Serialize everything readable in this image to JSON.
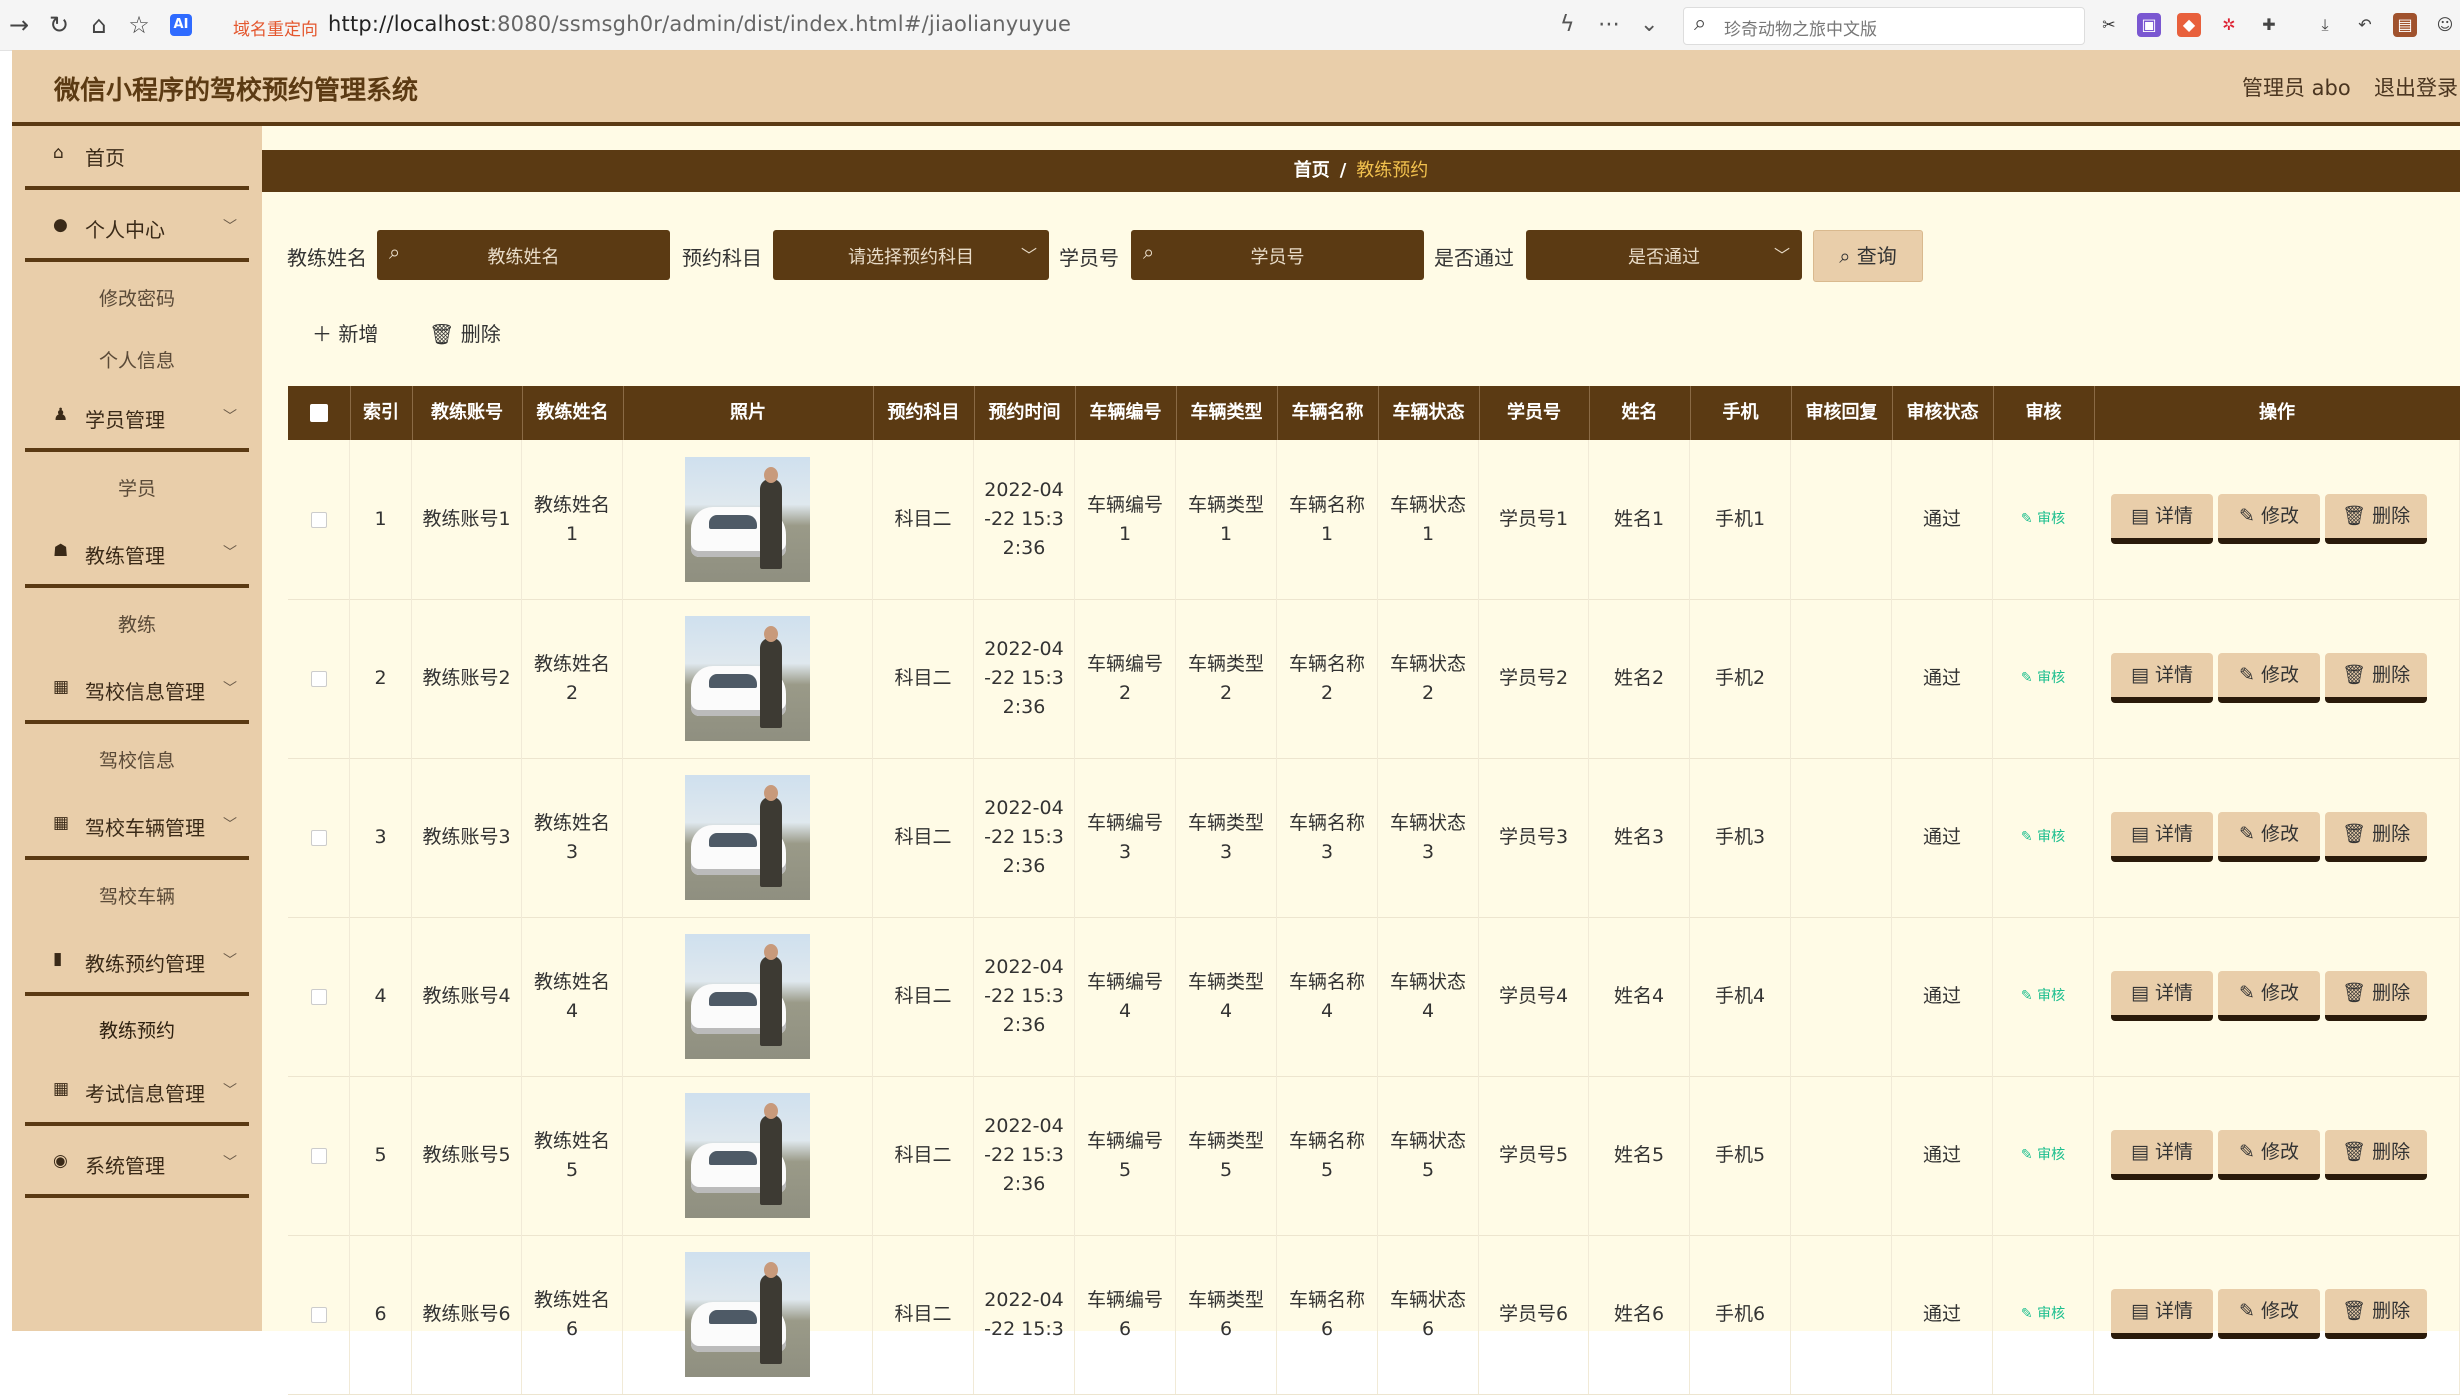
{
  "browser": {
    "redirect_label": "域名重定向",
    "url_host": "http://localhost",
    "url_rest": ":8080/ssmsgh0r/admin/dist/index.html#/jiaolianyuyue",
    "search_text": "珍奇动物之旅中文版"
  },
  "header": {
    "title": "微信小程序的驾校预约管理系统",
    "user": "管理员 abo",
    "logout": "退出登录"
  },
  "sidebar": {
    "home": "首页",
    "groups": [
      {
        "label": "个人中心",
        "subs": [
          "修改密码",
          "个人信息"
        ]
      },
      {
        "label": "学员管理",
        "subs": [
          "学员"
        ]
      },
      {
        "label": "教练管理",
        "subs": [
          "教练"
        ]
      },
      {
        "label": "驾校信息管理",
        "subs": [
          "驾校信息"
        ]
      },
      {
        "label": "驾校车辆管理",
        "subs": [
          "驾校车辆"
        ]
      },
      {
        "label": "教练预约管理",
        "subs": [
          "教练预约"
        ]
      },
      {
        "label": "考试信息管理",
        "subs": []
      },
      {
        "label": "系统管理",
        "subs": []
      }
    ]
  },
  "breadcrumb": {
    "home": "首页",
    "sep": "/",
    "current": "教练预约"
  },
  "filters": {
    "coach_name_label": "教练姓名",
    "coach_name_placeholder": "教练姓名",
    "subject_label": "预约科目",
    "subject_placeholder": "请选择预约科目",
    "student_no_label": "学员号",
    "student_no_placeholder": "学员号",
    "passed_label": "是否通过",
    "passed_placeholder": "是否通过",
    "query": "查询"
  },
  "actions": {
    "add": "新增",
    "delete": "删除"
  },
  "table": {
    "headers": [
      "索引",
      "教练账号",
      "教练姓名",
      "照片",
      "预约科目",
      "预约时间",
      "车辆编号",
      "车辆类型",
      "车辆名称",
      "车辆状态",
      "学员号",
      "姓名",
      "手机",
      "审核回复",
      "审核状态",
      "审核",
      "操作"
    ],
    "audit_label": "审核",
    "op_labels": {
      "detail": "详情",
      "edit": "修改",
      "delete": "删除"
    },
    "rows": [
      {
        "index": "1",
        "account": "教练账号1",
        "name": "教练姓名\n1",
        "subject": "科目二",
        "time": "2022-04\n-22 15:3\n2:36",
        "car_no": "车辆编号\n1",
        "car_type": "车辆类型\n1",
        "car_name": "车辆名称\n1",
        "car_status": "车辆状态\n1",
        "student_no": "学员号1",
        "student_name": "姓名1",
        "phone": "手机1",
        "reply": "",
        "status": "通过"
      },
      {
        "index": "2",
        "account": "教练账号2",
        "name": "教练姓名\n2",
        "subject": "科目二",
        "time": "2022-04\n-22 15:3\n2:36",
        "car_no": "车辆编号\n2",
        "car_type": "车辆类型\n2",
        "car_name": "车辆名称\n2",
        "car_status": "车辆状态\n2",
        "student_no": "学员号2",
        "student_name": "姓名2",
        "phone": "手机2",
        "reply": "",
        "status": "通过"
      },
      {
        "index": "3",
        "account": "教练账号3",
        "name": "教练姓名\n3",
        "subject": "科目二",
        "time": "2022-04\n-22 15:3\n2:36",
        "car_no": "车辆编号\n3",
        "car_type": "车辆类型\n3",
        "car_name": "车辆名称\n3",
        "car_status": "车辆状态\n3",
        "student_no": "学员号3",
        "student_name": "姓名3",
        "phone": "手机3",
        "reply": "",
        "status": "通过"
      },
      {
        "index": "4",
        "account": "教练账号4",
        "name": "教练姓名\n4",
        "subject": "科目二",
        "time": "2022-04\n-22 15:3\n2:36",
        "car_no": "车辆编号\n4",
        "car_type": "车辆类型\n4",
        "car_name": "车辆名称\n4",
        "car_status": "车辆状态\n4",
        "student_no": "学员号4",
        "student_name": "姓名4",
        "phone": "手机4",
        "reply": "",
        "status": "通过"
      },
      {
        "index": "5",
        "account": "教练账号5",
        "name": "教练姓名\n5",
        "subject": "科目二",
        "time": "2022-04\n-22 15:3\n2:36",
        "car_no": "车辆编号\n5",
        "car_type": "车辆类型\n5",
        "car_name": "车辆名称\n5",
        "car_status": "车辆状态\n5",
        "student_no": "学员号5",
        "student_name": "姓名5",
        "phone": "手机5",
        "reply": "",
        "status": "通过"
      },
      {
        "index": "6",
        "account": "教练账号6",
        "name": "教练姓名\n6",
        "subject": "科目二",
        "time": "2022-04\n-22 15:3",
        "car_no": "车辆编号\n6",
        "car_type": "车辆类型\n6",
        "car_name": "车辆名称\n6",
        "car_status": "车辆状态\n6",
        "student_no": "学员号6",
        "student_name": "姓名6",
        "phone": "手机6",
        "reply": "",
        "status": "通过"
      }
    ]
  }
}
